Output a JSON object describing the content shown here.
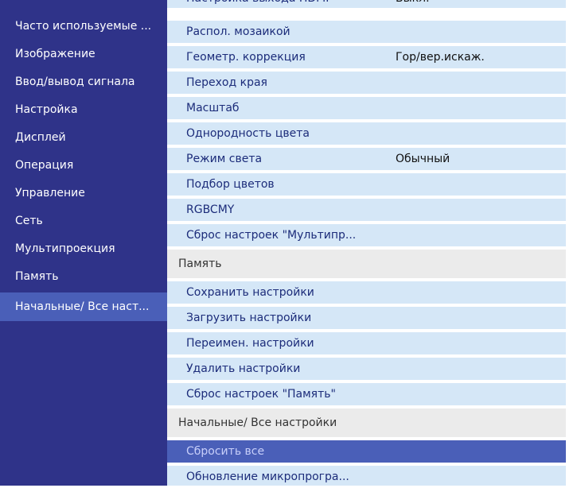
{
  "sidebar": {
    "items": [
      {
        "label": "Часто используемые ..."
      },
      {
        "label": "Изображение"
      },
      {
        "label": "Ввод/вывод сигнала"
      },
      {
        "label": "Настройка"
      },
      {
        "label": "Дисплей"
      },
      {
        "label": "Операция"
      },
      {
        "label": "Управление"
      },
      {
        "label": "Сеть"
      },
      {
        "label": "Мультипроекция"
      },
      {
        "label": "Память"
      },
      {
        "label": "Начальные/ Все наст..."
      }
    ],
    "selected": "Начальные/ Все наст..."
  },
  "main": {
    "top_partial": {
      "label": "Настройка выхода HDMI",
      "value": "Выкл."
    },
    "rows": [
      {
        "label": "Распол. мозаикой"
      },
      {
        "label": "Геометр. коррекция",
        "value": "Гор/вер.искаж."
      },
      {
        "label": "Переход края"
      },
      {
        "label": "Масштаб"
      },
      {
        "label": "Однородность цвета"
      },
      {
        "label": "Режим света",
        "value": "Обычный"
      },
      {
        "label": "Подбор цветов"
      },
      {
        "label": "RGBCMY"
      },
      {
        "label": "Сброс настроек \"Мультипр..."
      }
    ],
    "memory_header": "Память",
    "memory_rows": [
      {
        "label": "Сохранить настройки"
      },
      {
        "label": "Загрузить настройки"
      },
      {
        "label": "Переимен. настройки"
      },
      {
        "label": "Удалить настройки"
      },
      {
        "label": "Сброс настроек \"Память\""
      }
    ],
    "initial_header": "Начальные/ Все настройки",
    "initial_rows": [
      {
        "label": "Сбросить все",
        "selected": true
      },
      {
        "label": "Обновление микропрогра..."
      }
    ]
  },
  "colors": {
    "sidebar_bg": "#2f3389",
    "selected_bg": "#4a5fb8",
    "row_bg": "#d5e7f7",
    "header_bg": "#ebebeb",
    "row_text": "#1c2c7a"
  }
}
